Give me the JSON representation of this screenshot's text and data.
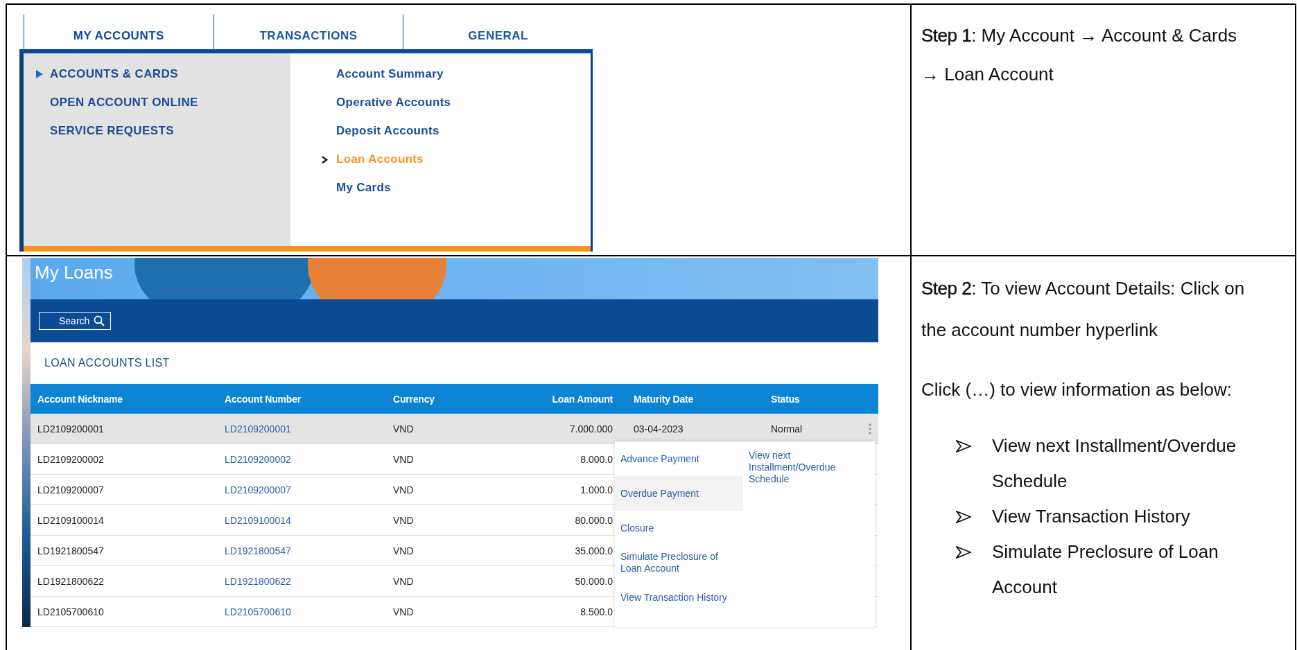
{
  "step1": {
    "screenshot": {
      "main_tabs": [
        {
          "label": "MY ACCOUNTS",
          "selected": true
        },
        {
          "label": "TRANSACTIONS",
          "selected": false
        },
        {
          "label": "GENERAL",
          "selected": false
        }
      ],
      "categories": [
        {
          "label": "ACCOUNTS & CARDS",
          "selected": true
        },
        {
          "label": "OPEN ACCOUNT ONLINE",
          "selected": false
        },
        {
          "label": "SERVICE REQUESTS",
          "selected": false
        }
      ],
      "items": [
        {
          "label": "Account Summary",
          "selected": false
        },
        {
          "label": "Operative Accounts",
          "selected": false
        },
        {
          "label": "Deposit Accounts",
          "selected": false
        },
        {
          "label": "Loan Accounts",
          "selected": true
        },
        {
          "label": "My Cards",
          "selected": false
        }
      ]
    },
    "text": "**Step 1**: My Account → Account & Cards → Loan Account"
  },
  "step2": {
    "screenshot": {
      "title": "My Loans",
      "search_button": "Search",
      "list_title": "LOAN ACCOUNTS LIST",
      "columns": [
        "Account Nickname",
        "Account Number",
        "Currency",
        "Loan Amount",
        "Maturity Date",
        "Status"
      ],
      "rows": [
        {
          "nickname": "LD2109200001",
          "number": "LD2109200001",
          "currency": "VND",
          "amount": "7.000.000",
          "maturity": "03-04-2023",
          "status": "Normal",
          "selected": true
        },
        {
          "nickname": "LD2109200002",
          "number": "LD2109200002",
          "currency": "VND",
          "amount": "8.000.0",
          "selected": false
        },
        {
          "nickname": "LD2109200007",
          "number": "LD2109200007",
          "currency": "VND",
          "amount": "1.000.0",
          "selected": false
        },
        {
          "nickname": "LD2109100014",
          "number": "LD2109100014",
          "currency": "VND",
          "amount": "80.000.0",
          "selected": false
        },
        {
          "nickname": "LD1921800547",
          "number": "LD1921800547",
          "currency": "VND",
          "amount": "35.000.0",
          "selected": false
        },
        {
          "nickname": "LD1921800622",
          "number": "LD1921800622",
          "currency": "VND",
          "amount": "50.000.0",
          "selected": false
        },
        {
          "nickname": "LD2105700610",
          "number": "LD2105700610",
          "currency": "VND",
          "amount": "8.500.0",
          "selected": false
        }
      ],
      "menu": {
        "items": [
          {
            "label": "Advance Payment",
            "selected": false
          },
          {
            "label": "Overdue Payment",
            "selected": true
          },
          {
            "label": "Closure",
            "selected": false
          },
          {
            "label": "Simulate Preclosure of Loan Account",
            "selected": false
          },
          {
            "label": "View Transaction History",
            "selected": false
          }
        ],
        "side_items": [
          {
            "label": "View next Installment/Overdue Schedule",
            "selected": false
          }
        ]
      }
    },
    "paragraphs": [
      "**Step 2**:  To view Account Details: Click on the account number hyperlink",
      "Click  (…) to view information as below:"
    ],
    "bullets": [
      "View next Installment/Overdue Schedule",
      "View Transaction History",
      "Simulate Preclosure of Loan Account"
    ]
  }
}
